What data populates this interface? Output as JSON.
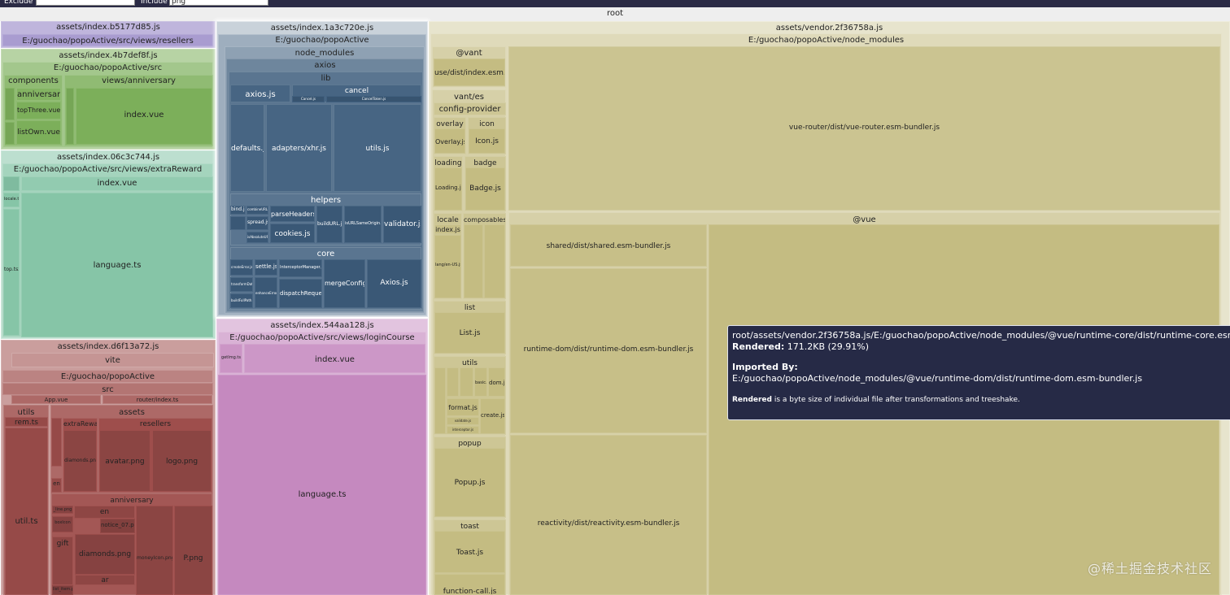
{
  "filter": {
    "exclude_label": "Exclude",
    "exclude_value": "",
    "include_label": "Include",
    "include_value": "png"
  },
  "root_label": "root",
  "chunks": {
    "resellers_bundle": {
      "title": "assets/index.b5177d85.js",
      "path": "E:/guochao/popoActive/src/views/resellers"
    },
    "anniversary_bundle": {
      "title": "assets/index.4b7def8f.js",
      "path": "E:/guochao/popoActive/src",
      "components": "components",
      "anniversary": "anniversary",
      "topthree": "topThree.vue",
      "listown": "listOwn.vue",
      "views_anniversary": "views/anniversary",
      "index_vue": "index.vue"
    },
    "extra_bundle": {
      "title": "assets/index.06c3c744.js",
      "path": "E:/guochao/popoActive/src/views/extraReward",
      "index_vue": "index.vue",
      "language": "language.ts",
      "locale_ts": "locale.ts",
      "top_tsx": "top.tsx"
    },
    "main_bundle": {
      "title": "assets/index.d6f13a72.js",
      "vite": "vite",
      "path": "E:/guochao/popoActive",
      "src": "src",
      "app_vue": "App.vue",
      "router": "router/index.ts",
      "utils": "utils",
      "rem": "rem.ts",
      "util": "util.ts",
      "assets": "assets",
      "extra": "extraReward",
      "resellers": "resellers",
      "diamonds_small": "diamonds.png",
      "avatar": "avatar.png",
      "logo": "logo.png",
      "ar": "ar",
      "en": "en",
      "anniversary": "anniversary",
      "line_png": "_line.png",
      "en2": "en",
      "notice": "notice_07.png",
      "box_icon": "boxIcon",
      "gift": "gift",
      "diamonds": "diamonds.png",
      "money_icon": "moneyIcon.png",
      "p_png": "P.png",
      "ar2": "ar",
      "list_item": "list_item.png"
    },
    "axios_bundle": {
      "title": "assets/index.1a3c720e.js",
      "path": "E:/guochao/popoActive",
      "node_modules": "node_modules",
      "axios": "axios",
      "lib": "lib",
      "axios_js": "axios.js",
      "cancel": "cancel",
      "cancel_js": "Cancel.js",
      "cancel_token": "CancelToken.js",
      "defaults": "defaults.js",
      "adapters": "adapters/xhr.js",
      "utils": "utils.js",
      "helpers": "helpers",
      "bind": "bind.js",
      "combine": "combineURLs.js",
      "spread": "spread.js",
      "absolute": "isAbsoluteURL.js",
      "parse_headers": "parseHeaders.js",
      "cookies": "cookies.js",
      "build_url": "buildURL.js",
      "same_origin": "isURLSameOrigin.js",
      "validator": "validator.js",
      "core": "core",
      "create_error": "createError.js",
      "transform": "transformData.js",
      "build_full": "buildFullPath.js",
      "settle": "settle.js",
      "enhance": "enhanceError.js",
      "interceptor": "InterceptorManager.js",
      "dispatch": "dispatchRequest.js",
      "merge": "mergeConfig.js",
      "axios_core": "Axios.js"
    },
    "login_bundle": {
      "title": "assets/index.544aa128.js",
      "path": "E:/guochao/popoActive/src/views/loginCourse",
      "getimg": "getImg.ts",
      "index_vue": "index.vue",
      "language": "language.ts"
    },
    "vendor_bundle": {
      "title": "assets/vendor.2f36758a.js",
      "path": "E:/guochao/popoActive/node_modules",
      "vant_scope": "@vant",
      "use_dist": "use/dist/index.esm.js",
      "vant_es": "vant/es",
      "config_provider": "config-provider",
      "overlay": "overlay",
      "overlay_js": "Overlay.js",
      "icon": "icon",
      "icon_js": "Icon.js",
      "loading": "loading",
      "loading_js": "Loading.js",
      "badge": "badge",
      "badge_js": "Badge.js",
      "locale": "locale",
      "index_js": "index.js",
      "lang": "lang/en-US.js",
      "composables": "composables",
      "list": "list",
      "list_js": "List.js",
      "utils": "utils",
      "dom_js": "dom.js",
      "basic": "basic.js",
      "format": "format.js",
      "create": "create.js",
      "validate": "validate.js",
      "interceptor": "interceptor.js",
      "popup": "popup",
      "popup_js": "Popup.js",
      "toast": "toast",
      "toast_js": "Toast.js",
      "function_call": "function-call.js",
      "vue_router": "vue-router/dist/vue-router.esm-bundler.js",
      "vue_scope": "@vue",
      "shared": "shared/dist/shared.esm-bundler.js",
      "runtime_dom": "runtime-dom/dist/runtime-dom.esm-bundler.js",
      "reactivity": "reactivity/dist/reactivity.esm-bundler.js",
      "runtime_core": "runtime-core/dist/runtime-core.esm-bundler.js"
    }
  },
  "tooltip": {
    "path": "root/assets/vendor.2f36758a.js/E:/guochao/popoActive/node_modules/@vue/runtime-core/dist/runtime-core.esm-bundler.js",
    "rendered_label": "Rendered:",
    "rendered_value": "171.2KB (29.91%)",
    "imported_by_label": "Imported By:",
    "imported_by_value": "E:/guochao/popoActive/node_modules/@vue/runtime-dom/dist/runtime-dom.esm-bundler.js",
    "note_bold": "Rendered",
    "note_rest": " is a byte size of individual file after transformations and treeshake."
  },
  "watermark": "@稀土掘金技术社区",
  "colors": {
    "lavender": "#a99cd0",
    "green": "#7caf5a",
    "teal": "#86c5a7",
    "red": "#9e4e4c",
    "steel": "#3d5d7c",
    "magenta": "#c589bf",
    "olive": "#c4bc82",
    "tooltip_bg": "#262a46"
  }
}
